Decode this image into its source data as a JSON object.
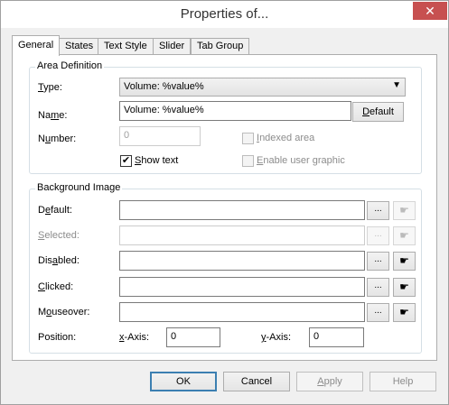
{
  "window": {
    "title": "Properties of...",
    "close_glyph": "✕"
  },
  "tabs": [
    {
      "label": "General",
      "active": true
    },
    {
      "label": "States"
    },
    {
      "label": "Text Style"
    },
    {
      "label": "Slider"
    },
    {
      "label": "Tab Group"
    }
  ],
  "area": {
    "group_label": "Area Definition",
    "type_label_u": "T",
    "type_label_rest": "ype:",
    "type_value": "Volume: %value%",
    "name_label_pre": "Na",
    "name_label_u": "m",
    "name_label_rest": "e:",
    "name_value": "Volume: %value%",
    "default_btn_u": "D",
    "default_btn_rest": "efault",
    "number_label_pre": "N",
    "number_label_u": "u",
    "number_label_rest": "mber:",
    "number_value": "0",
    "indexed_label_u": "I",
    "indexed_label_rest": "ndexed area",
    "show_text_label_u": "S",
    "show_text_label_rest": "how text",
    "show_text_checked": true,
    "enable_graphic_label_u": "E",
    "enable_graphic_label_rest": "nable user graphic"
  },
  "background": {
    "group_label": "Background Image",
    "rows": [
      {
        "label_pre": "D",
        "label_u": "e",
        "label_rest": "fault:",
        "value": "",
        "enabled": true
      },
      {
        "label_pre": "",
        "label_u": "S",
        "label_rest": "elected:",
        "value": "",
        "enabled": false
      },
      {
        "label_pre": "Dis",
        "label_u": "a",
        "label_rest": "bled:",
        "value": "",
        "enabled": true
      },
      {
        "label_pre": "",
        "label_u": "C",
        "label_rest": "licked:",
        "value": "",
        "enabled": true
      },
      {
        "label_pre": "M",
        "label_u": "o",
        "label_rest": "useover:",
        "value": "",
        "enabled": true
      }
    ],
    "browse_label": "...",
    "pick_icon": "☛",
    "position_label": "Position:",
    "x_label_u": "x",
    "x_label_rest": "-Axis:",
    "x_value": "0",
    "y_label_u": "y",
    "y_label_rest": "-Axis:",
    "y_value": "0"
  },
  "footer": {
    "ok": "OK",
    "cancel": "Cancel",
    "apply_u": "A",
    "apply_rest": "pply",
    "help": "Help"
  }
}
